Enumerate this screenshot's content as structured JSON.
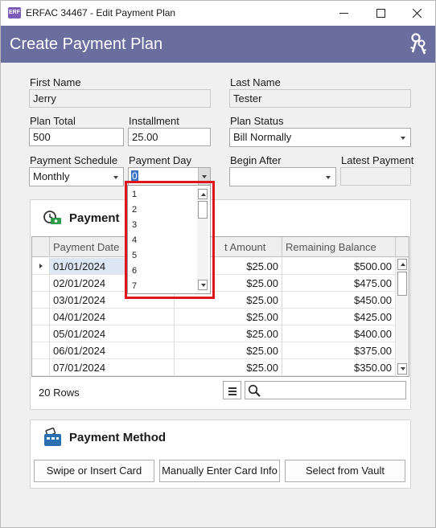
{
  "window": {
    "title": "ERFAC 34467 - Edit Payment Plan",
    "app_icon_text": "ERF",
    "minimize_icon": "minimize-icon",
    "maximize_icon": "maximize-icon",
    "close_icon": "close-icon"
  },
  "header": {
    "title": "Create Payment Plan",
    "icon": "keys-icon",
    "background": "#6a6e9f"
  },
  "form": {
    "first_name": {
      "label": "First Name",
      "value": "Jerry"
    },
    "last_name": {
      "label": "Last Name",
      "value": "Tester"
    },
    "plan_total": {
      "label": "Plan Total",
      "value": "500"
    },
    "installment": {
      "label": "Installment",
      "value": "25.00"
    },
    "plan_status": {
      "label": "Plan Status",
      "value": "Bill Normally"
    },
    "payment_schedule": {
      "label": "Payment Schedule",
      "value": "Monthly"
    },
    "payment_day": {
      "label": "Payment Day",
      "value": "0"
    },
    "begin_after": {
      "label": "Begin After",
      "value": ""
    },
    "latest_payment": {
      "label": "Latest Payment",
      "value": ""
    }
  },
  "payment_day_options": [
    "1",
    "2",
    "3",
    "4",
    "5",
    "6",
    "7"
  ],
  "payments_panel": {
    "title": "Payment",
    "icon": "cash-clock-icon",
    "columns": [
      "Payment Date",
      "t Amount",
      "Remaining Balance"
    ],
    "rows": [
      {
        "date": "01/01/2024",
        "amount": "$25.00",
        "balance": "$500.00"
      },
      {
        "date": "02/01/2024",
        "amount": "$25.00",
        "balance": "$475.00"
      },
      {
        "date": "03/01/2024",
        "amount": "$25.00",
        "balance": "$450.00"
      },
      {
        "date": "04/01/2024",
        "amount": "$25.00",
        "balance": "$425.00"
      },
      {
        "date": "05/01/2024",
        "amount": "$25.00",
        "balance": "$400.00"
      },
      {
        "date": "06/01/2024",
        "amount": "$25.00",
        "balance": "$375.00"
      },
      {
        "date": "07/01/2024",
        "amount": "$25.00",
        "balance": "$350.00"
      }
    ],
    "row_count": "20 Rows",
    "search_placeholder": ""
  },
  "payment_method": {
    "title": "Payment Method",
    "icon": "card-reader-icon",
    "buttons": [
      "Swipe or Insert Card",
      "Manually Enter Card Info",
      "Select from Vault"
    ]
  },
  "colors": {
    "highlight_box": "#e0141b",
    "selection": "#3a74c5"
  }
}
